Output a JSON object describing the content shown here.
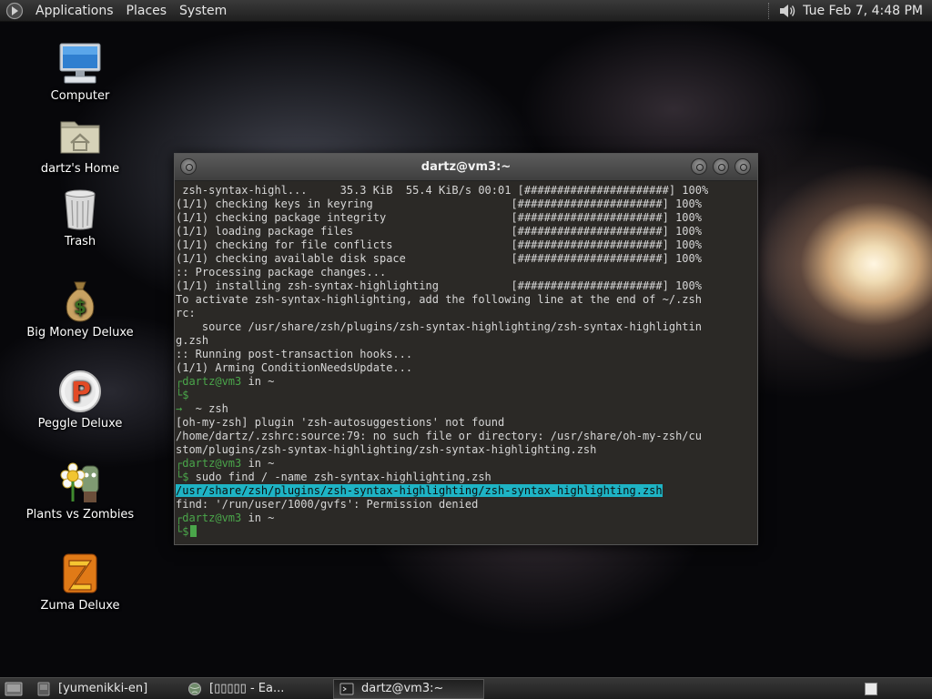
{
  "top_panel": {
    "menus": [
      "Applications",
      "Places",
      "System"
    ],
    "clock": "Tue Feb  7,  4:48 PM"
  },
  "desktop_icons": [
    {
      "label": "Computer",
      "icon": "computer-icon"
    },
    {
      "label": "dartz's Home",
      "icon": "home-folder-icon"
    },
    {
      "label": "Trash",
      "icon": "trash-icon"
    },
    {
      "label": "Big Money Deluxe",
      "icon": "money-bag-icon"
    },
    {
      "label": "Peggle Deluxe",
      "icon": "peggle-icon"
    },
    {
      "label": "Plants vs Zombies",
      "icon": "plants-vs-zombies-icon"
    },
    {
      "label": "Zuma Deluxe",
      "icon": "zuma-icon"
    }
  ],
  "terminal": {
    "title": "dartz@vm3:~",
    "lines": [
      {
        "text": " zsh-syntax-highl...     35.3 KiB  55.4 KiB/s 00:01 [######################] 100%"
      },
      {
        "text": "(1/1) checking keys in keyring                     [######################] 100%"
      },
      {
        "text": "(1/1) checking package integrity                   [######################] 100%"
      },
      {
        "text": "(1/1) loading package files                        [######################] 100%"
      },
      {
        "text": "(1/1) checking for file conflicts                  [######################] 100%"
      },
      {
        "text": "(1/1) checking available disk space                [######################] 100%"
      },
      {
        "text": ":: Processing package changes..."
      },
      {
        "text": "(1/1) installing zsh-syntax-highlighting           [######################] 100%"
      },
      {
        "text": "To activate zsh-syntax-highlighting, add the following line at the end of ~/.zsh"
      },
      {
        "text": "rc:"
      },
      {
        "text": "    source /usr/share/zsh/plugins/zsh-syntax-highlighting/zsh-syntax-highlightin"
      },
      {
        "text": "g.zsh"
      },
      {
        "text": ":: Running post-transaction hooks..."
      },
      {
        "text": "(1/1) Arming ConditionNeedsUpdate..."
      },
      {
        "prompt": "dartz@vm3",
        "suffix": " in ~"
      },
      {
        "input": ""
      },
      {
        "arrow": "→",
        "text": "  ~ zsh"
      },
      {
        "text": "[oh-my-zsh] plugin 'zsh-autosuggestions' not found"
      },
      {
        "text": "/home/dartz/.zshrc:source:79: no such file or directory: /usr/share/oh-my-zsh/cu"
      },
      {
        "text": "stom/plugins/zsh-syntax-highlighting/zsh-syntax-highlighting.zsh"
      },
      {
        "prompt": "dartz@vm3",
        "suffix": " in ~"
      },
      {
        "input": " sudo find / -name zsh-syntax-highlighting.zsh"
      },
      {
        "highlight": "/usr/share/zsh/plugins/zsh-syntax-highlighting/zsh-syntax-highlighting.zsh"
      },
      {
        "text": "find: '/run/user/1000/gvfs': Permission denied"
      },
      {
        "prompt": "dartz@vm3",
        "suffix": " in ~"
      },
      {
        "input": "",
        "cursor": true
      }
    ],
    "prompt_marker_top": "┌",
    "prompt_marker_bottom": "└",
    "prompt_symbol": "$"
  },
  "taskbar": {
    "tasks": [
      {
        "label": "[yumenikki-en]",
        "icon": "app-icon",
        "active": false
      },
      {
        "label": "[▯▯▯▯▯ - Ea...",
        "icon": "globe-icon",
        "active": false
      },
      {
        "label": "dartz@vm3:~",
        "icon": "terminal-icon",
        "active": true
      }
    ]
  },
  "colors": {
    "terminal_bg": "#2b2926",
    "prompt_green": "#4aa54a",
    "highlight_cyan": "#1eb3c4"
  }
}
